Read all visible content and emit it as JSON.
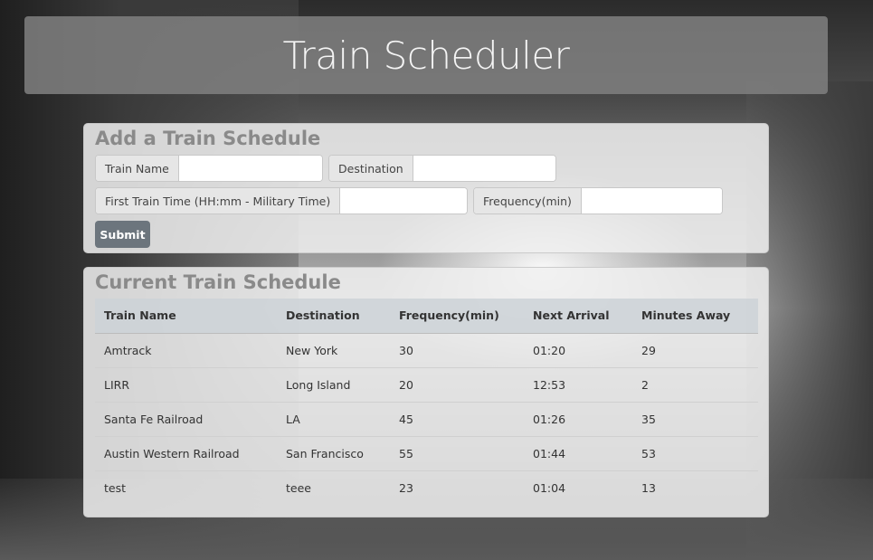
{
  "header": {
    "title": "Train Scheduler"
  },
  "add_form": {
    "title": "Add a Train Schedule",
    "train_name_label": "Train Name",
    "train_name_value": "",
    "destination_label": "Destination",
    "destination_value": "",
    "first_time_label": "First Train Time (HH:mm - Military Time)",
    "first_time_value": "",
    "frequency_label": "Frequency(min)",
    "frequency_value": "",
    "submit_label": "Submit"
  },
  "schedule": {
    "title": "Current Train Schedule",
    "columns": [
      "Train Name",
      "Destination",
      "Frequency(min)",
      "Next Arrival",
      "Minutes Away"
    ],
    "rows": [
      [
        "Amtrack",
        "New York",
        "30",
        "01:20",
        "29"
      ],
      [
        "LIRR",
        "Long Island",
        "20",
        "12:53",
        "2"
      ],
      [
        "Santa Fe Railroad",
        "LA",
        "45",
        "01:26",
        "35"
      ],
      [
        "Austin Western Railroad",
        "San Francisco",
        "55",
        "01:44",
        "53"
      ],
      [
        "test",
        "teee",
        "23",
        "01:04",
        "13"
      ]
    ]
  },
  "colors": {
    "header_bg": "#808080",
    "card_bg": "#f0f0f0",
    "card_title": "#8a8a8a",
    "button_bg": "#6c757d"
  }
}
